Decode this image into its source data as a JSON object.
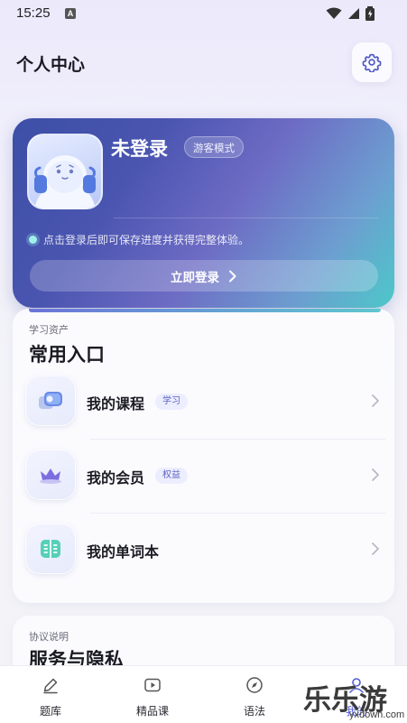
{
  "status_bar": {
    "time": "15:25",
    "notif_letter": "A"
  },
  "header": {
    "title": "个人中心",
    "settings_icon": "gear-icon"
  },
  "profile": {
    "status": "未登录",
    "badge": "游客模式",
    "hint": "点击登录后即可保存进度并获得完整体验。",
    "login_button": "立即登录"
  },
  "entries": {
    "caption": "学习资产",
    "title": "常用入口",
    "items": [
      {
        "label": "我的课程",
        "tag": "学习",
        "icon": "course-icon"
      },
      {
        "label": "我的会员",
        "tag": "权益",
        "icon": "crown-icon"
      },
      {
        "label": "我的单词本",
        "tag": "",
        "icon": "notebook-icon"
      }
    ]
  },
  "agreement": {
    "caption": "协议说明",
    "title": "服务与隐私"
  },
  "nav": {
    "items": [
      {
        "label": "题库",
        "icon": "edit-icon"
      },
      {
        "label": "精品课",
        "icon": "play-icon"
      },
      {
        "label": "语法",
        "icon": "compass-icon"
      },
      {
        "label": "我的",
        "icon": "user-icon"
      }
    ],
    "active_index": 3
  },
  "watermark": {
    "text": "乐乐游戏",
    "url": "yxdown.com"
  },
  "colors": {
    "accent": "#4f5bd5",
    "card_gradient_start": "#3c4fa6",
    "card_gradient_end": "#4cc8c9"
  }
}
